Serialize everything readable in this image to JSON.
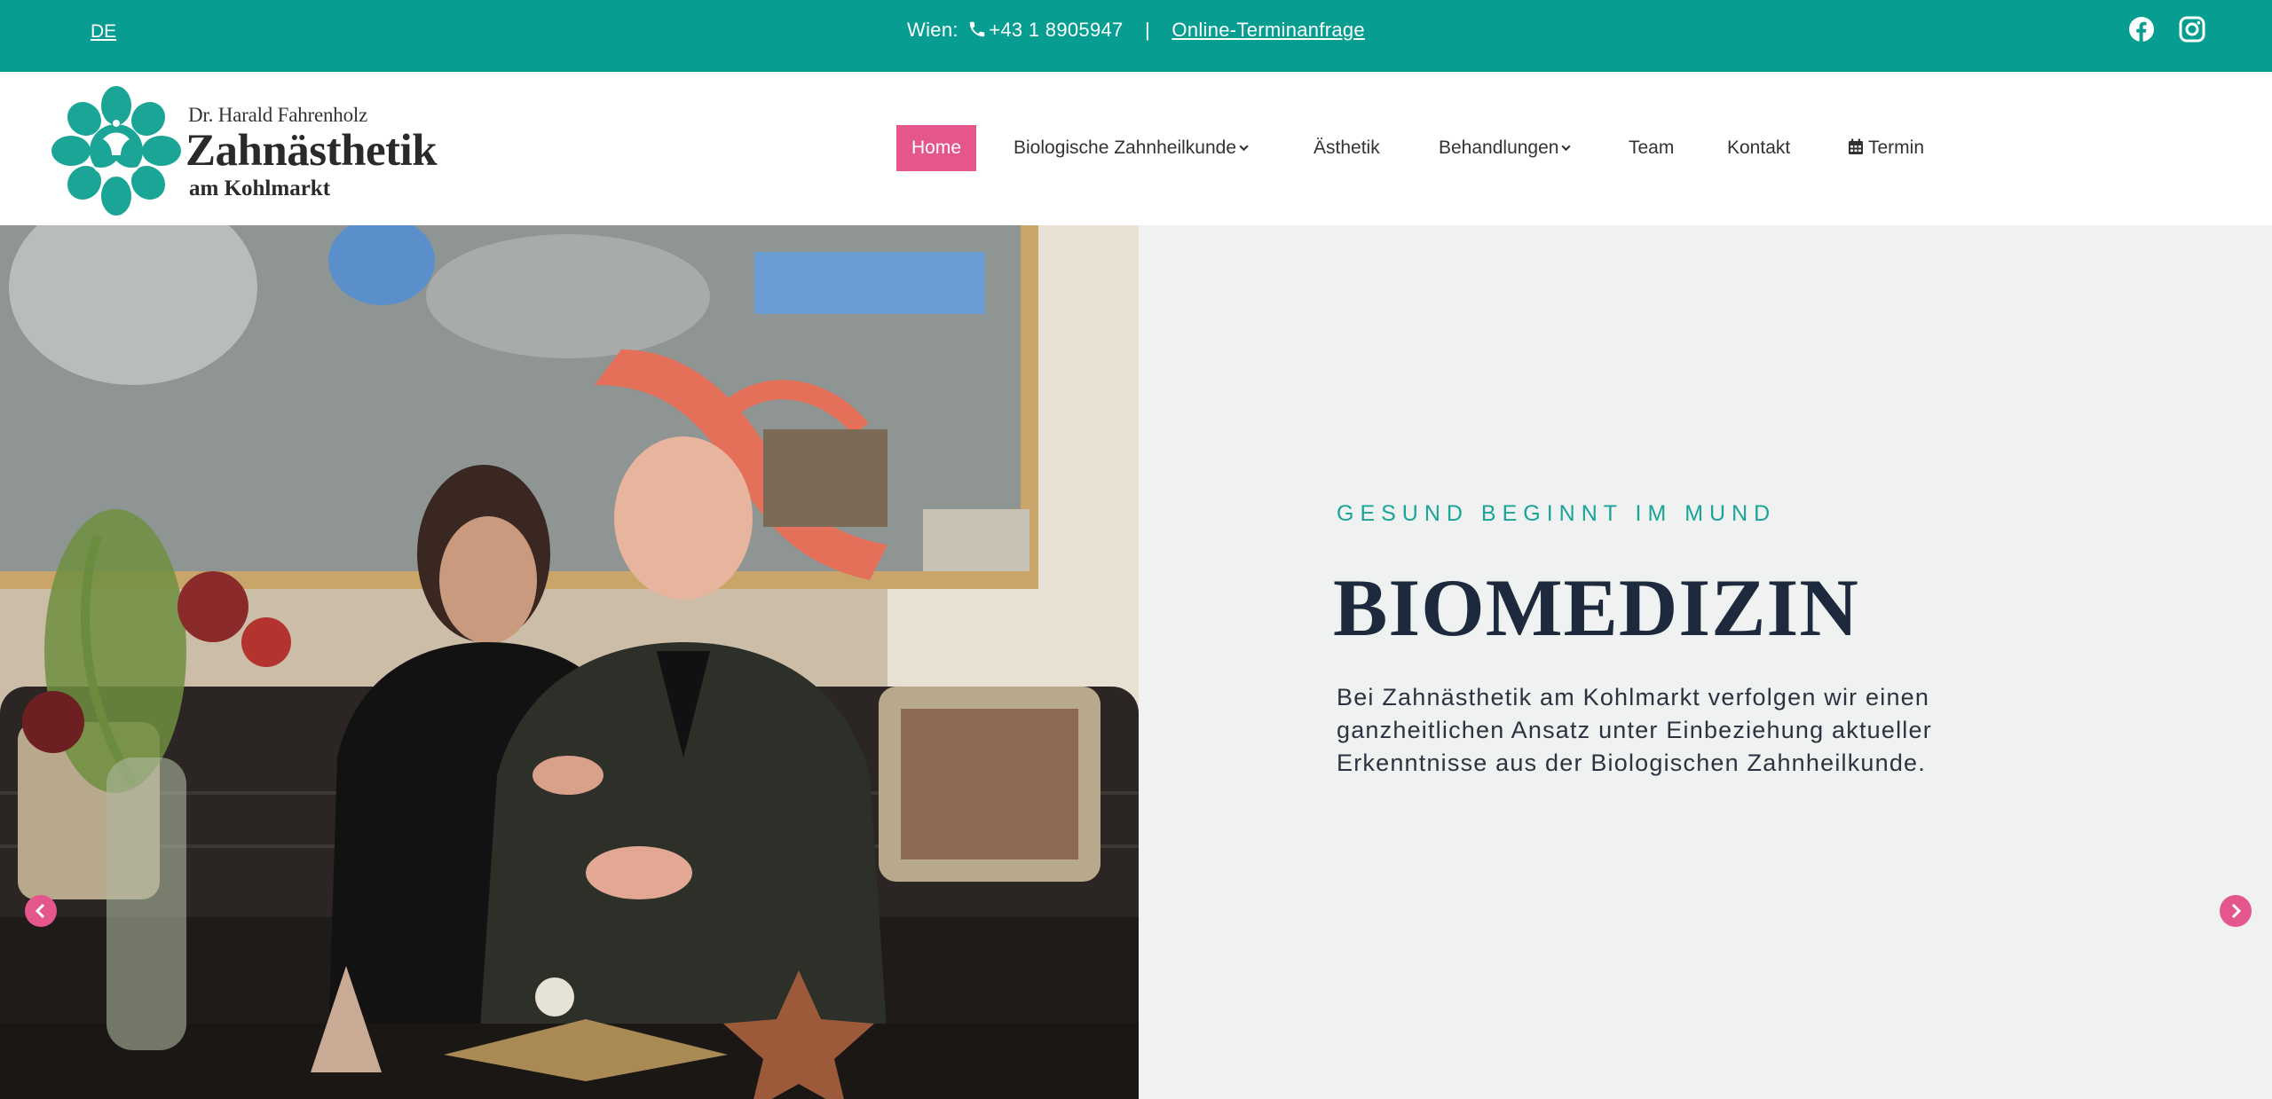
{
  "topbar": {
    "language": "DE",
    "city_label": "Wien:",
    "phone": "+43 1 8905947",
    "separator": "|",
    "appointment_link": "Online-Terminanfrage"
  },
  "logo": {
    "line1": "Dr. Harald Fahrenholz",
    "line2": "Zahnästhetik",
    "line3": "am Kohlmarkt"
  },
  "nav": {
    "home": "Home",
    "bio": "Biologische Zahnheilkunde",
    "aesthetik": "Ästhetik",
    "behandlungen": "Behandlungen",
    "team": "Team",
    "kontakt": "Kontakt",
    "termin": "Termin"
  },
  "hero": {
    "eyebrow": "GESUND BEGINNT IM MUND",
    "title": "BIOMEDIZIN",
    "text": "Bei Zahnästhetik am Kohlmarkt verfolgen wir einen ganzheitlichen Ansatz unter Einbeziehung aktueller Erkenntnisse aus der Biologischen Zahnheilkunde."
  },
  "icons": {
    "phone": "phone-icon",
    "facebook": "facebook-icon",
    "instagram": "instagram-icon",
    "chevron": "chevron-down-icon",
    "calendar": "calendar-icon",
    "prev": "chevron-left-icon",
    "next": "chevron-right-icon"
  },
  "colors": {
    "topbar": "#079e91",
    "accent_pink": "#e5568d",
    "eyebrow_teal": "#1ba497",
    "headline": "#1d2a3e",
    "hero_bg": "#eff2f1"
  }
}
